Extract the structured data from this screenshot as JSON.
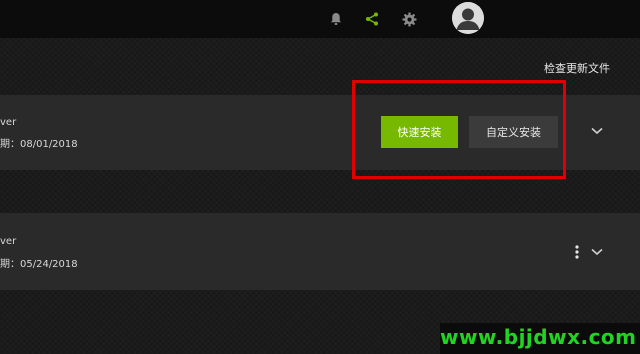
{
  "header": {
    "icons": [
      "bell-icon",
      "share-icon",
      "gear-icon",
      "user-avatar-icon"
    ],
    "accent_color": "#76b900"
  },
  "check_updates_label": "检查更新文件",
  "drivers": [
    {
      "name_fragment": "ver",
      "date_fragment": "期：08/01/2018",
      "express_install_label": "快速安装",
      "custom_install_label": "自定义安装"
    },
    {
      "name_fragment": "ver",
      "date_fragment": "期：05/24/2018"
    }
  ],
  "watermark": "www.bjjdwx.com",
  "colors": {
    "express_button": "#76b900",
    "highlight_box": "#e00000",
    "watermark_text": "#22d422"
  }
}
